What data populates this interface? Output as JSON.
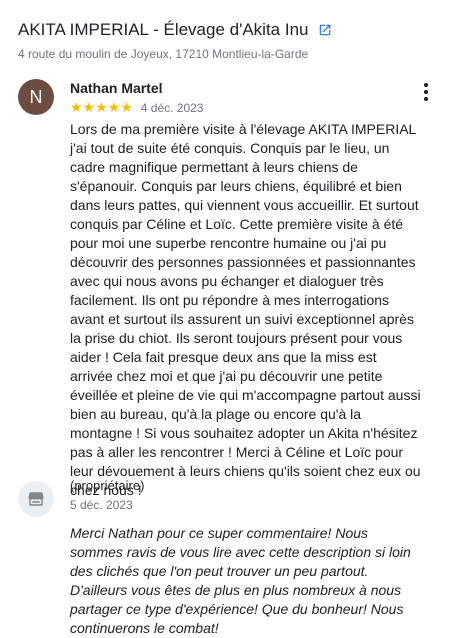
{
  "business": {
    "name": "AKITA IMPERIAL - Élevage d'Akita Inu",
    "address": "4 route du moulin de Joyeux, 17210 Montlieu-la-Garde",
    "link_icon": "external-link-icon"
  },
  "review": {
    "avatar_letter": "N",
    "avatar_color": "#6d4c41",
    "author": "Nathan Martel",
    "stars": "★★★★★",
    "rating": 5,
    "date": "4 déc. 2023",
    "menu_icon": "more-vert-icon",
    "text": "Lors de ma première visite à l'élevage AKITA IMPERIAL j'ai tout de suite été conquis. Conquis par le lieu, un cadre magnifique permettant à leurs chiens de s'épanouir. Conquis par leurs chiens, équilibré et bien dans leurs pattes, qui viennent vous accueillir. Et surtout conquis par Céline et Loïc. Cette première visite à été pour moi une superbe rencontre humaine ou j'ai pu découvrir des personnes passionnées et passionnantes avec qui nous avons pu échanger et dialoguer très facilement. Ils ont pu répondre à mes interrogations avant et surtout ils assurent un suivi exceptionnel après la prise du chiot. Ils seront toujours présent pour vous aider ! Cela fait presque deux ans que la miss est arrivée chez moi et que j'ai pu découvrir une petite éveillée et pleine de vie qui m'accompagne partout aussi bien au bureau, qu'à la plage ou encore qu'à la montagne ! Si vous souhaitez adopter un Akita n'hésitez pas à aller les rencontrer ! Merci à Céline et Loïc pour leur dévouement à leurs chiens qu'ils soient chez eux ou chez nous !"
  },
  "owner_reply": {
    "icon": "storefront-icon",
    "label": "(propriétaire)",
    "date": "5 déc. 2023",
    "text": "Merci Nathan pour ce super commentaire! Nous sommes ravis de vous lire avec cette description si loin des clichés que l'on peut trouver un peu partout. D'ailleurs vous êtes de plus en plus nombreux à nous partager ce type d'expérience! Que du bonheur! Nous continuerons le combat!"
  },
  "colors": {
    "stars": "#fbbc04",
    "link": "#1a73e8",
    "secondary_text": "#70757a"
  }
}
